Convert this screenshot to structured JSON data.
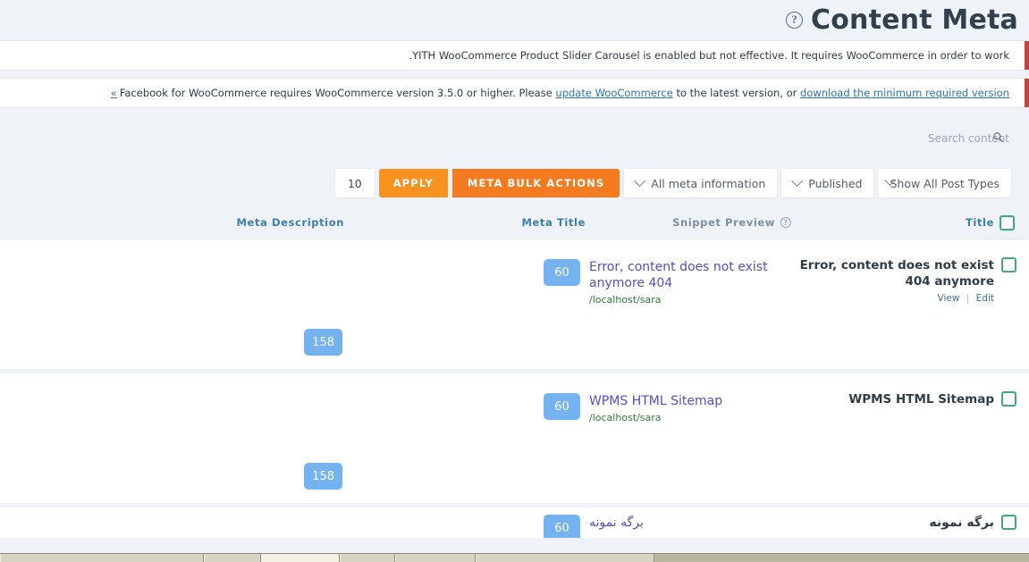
{
  "header": {
    "title": "Content Meta",
    "help_icon": "question-circle-icon"
  },
  "notices": [
    {
      "id": "yith-notice",
      "text": ".YITH WooCommerce Product Slider Carousel is enabled but not effective. It requires WooCommerce in order to work",
      "accent_color": "#c8413c"
    },
    {
      "id": "facebook-woocommerce-notice",
      "dismiss": "«",
      "text_start": "Facebook for WooCommerce requires WooCommerce version 3.5.0 or higher. Please ",
      "link1": "update WooCommerce",
      "text_mid": " to the latest version, or ",
      "link2": "download the minimum required version",
      "accent_color": "#c8413c"
    }
  ],
  "search": {
    "placeholder": "Search content",
    "value": "",
    "icon": "search-icon"
  },
  "toolbar": {
    "post_types_select": "Show All Post Types",
    "status_select": "Published",
    "meta_select": "All meta information",
    "bulk_actions_button": "META BULK ACTIONS",
    "apply_button": "APPLY",
    "per_page_value": "10",
    "bulk_color": "#f47b20",
    "apply_color": "#f7921e"
  },
  "table": {
    "columns": {
      "title": "Title",
      "snippet_preview": "Snippet Preview",
      "meta_title": "Meta Title",
      "meta_description": "Meta Description"
    },
    "select_all_checkbox": "unchecked",
    "checkbox_color": "#3fa883",
    "badge_color": "#74b3ef",
    "rows": [
      {
        "title": "Error, content does not exist 404 anymore",
        "actions": {
          "view": "View",
          "edit": "Edit"
        },
        "snippet_title": "Error, content does not exist anymore 404",
        "snippet_url": "/localhost/sara",
        "meta_title_count": "60",
        "meta_desc_count": "158",
        "checkbox": "unchecked"
      },
      {
        "title": "WPMS HTML Sitemap",
        "actions": {
          "view": "",
          "edit": ""
        },
        "snippet_title": "WPMS HTML Sitemap",
        "snippet_url": "/localhost/sara",
        "meta_title_count": "60",
        "meta_desc_count": "158",
        "checkbox": "unchecked"
      },
      {
        "title": "برگه نمونه",
        "actions": {
          "view": "",
          "edit": ""
        },
        "snippet_title": "برگه نمونه",
        "snippet_url": "",
        "meta_title_count": "60",
        "meta_desc_count": "",
        "checkbox": "unchecked"
      }
    ]
  }
}
